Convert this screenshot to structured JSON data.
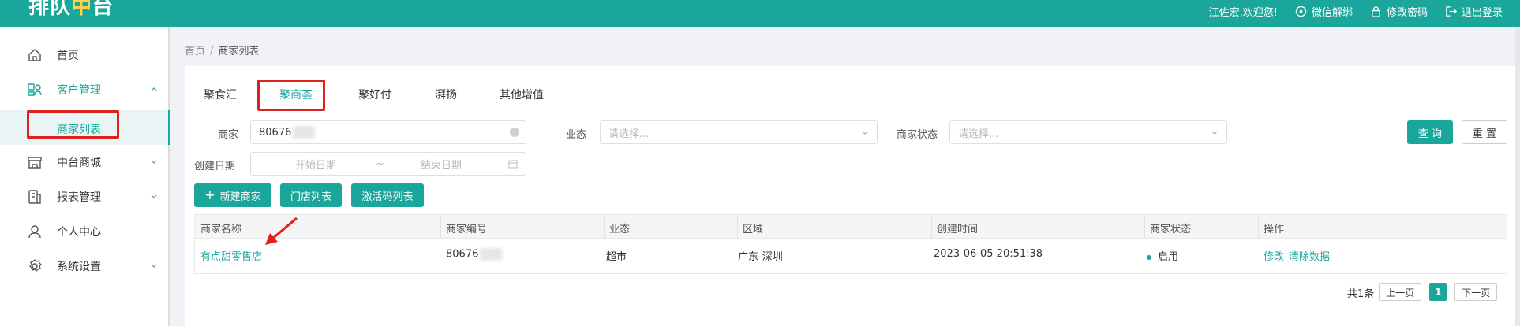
{
  "header": {
    "logo_main": "排队",
    "logo_accent": "中",
    "logo_tail": "台",
    "welcome": "江佐宏,欢迎您!",
    "wechat_unbind": "微信解绑",
    "change_password": "修改密码",
    "logout": "退出登录"
  },
  "sidebar": {
    "items": [
      {
        "label": "首页",
        "icon": "home-icon"
      },
      {
        "label": "客户管理",
        "icon": "customer-icon"
      },
      {
        "label": "中台商城",
        "icon": "store-icon"
      },
      {
        "label": "报表管理",
        "icon": "report-icon"
      },
      {
        "label": "个人中心",
        "icon": "user-icon"
      },
      {
        "label": "系统设置",
        "icon": "settings-icon"
      }
    ],
    "subitem": "商家列表"
  },
  "breadcrumb": {
    "home": "首页",
    "sep": "/",
    "current": "商家列表"
  },
  "tabs": [
    "聚食汇",
    "聚商荟",
    "聚好付",
    "湃扬",
    "其他增值"
  ],
  "filters": {
    "merchant_label": "商家",
    "merchant_value": "80676",
    "business_label": "业态",
    "business_placeholder": "请选择...",
    "status_label": "商家状态",
    "status_placeholder": "请选择...",
    "date_label": "创建日期",
    "date_start": "开始日期",
    "date_sep": "~",
    "date_end": "结束日期",
    "query": "查 询",
    "reset": "重 置"
  },
  "actions": {
    "new_merchant": "新建商家",
    "store_list": "门店列表",
    "activation_list": "激活码列表"
  },
  "table": {
    "headers": [
      "商家名称",
      "商家编号",
      "业态",
      "区域",
      "创建时间",
      "商家状态",
      "操作"
    ],
    "rows": [
      {
        "name": "有点甜零售店",
        "code": "80676",
        "business": "超市",
        "region": "广东-深圳",
        "created": "2023-06-05 20:51:38",
        "status": "启用",
        "op_edit": "修改",
        "op_clear": "清除数据"
      }
    ]
  },
  "pagination": {
    "total": "共1条",
    "prev": "上一页",
    "current": "1",
    "next": "下一页"
  },
  "colors": {
    "accent": "#1ba69b",
    "annotation": "#e0201b"
  }
}
